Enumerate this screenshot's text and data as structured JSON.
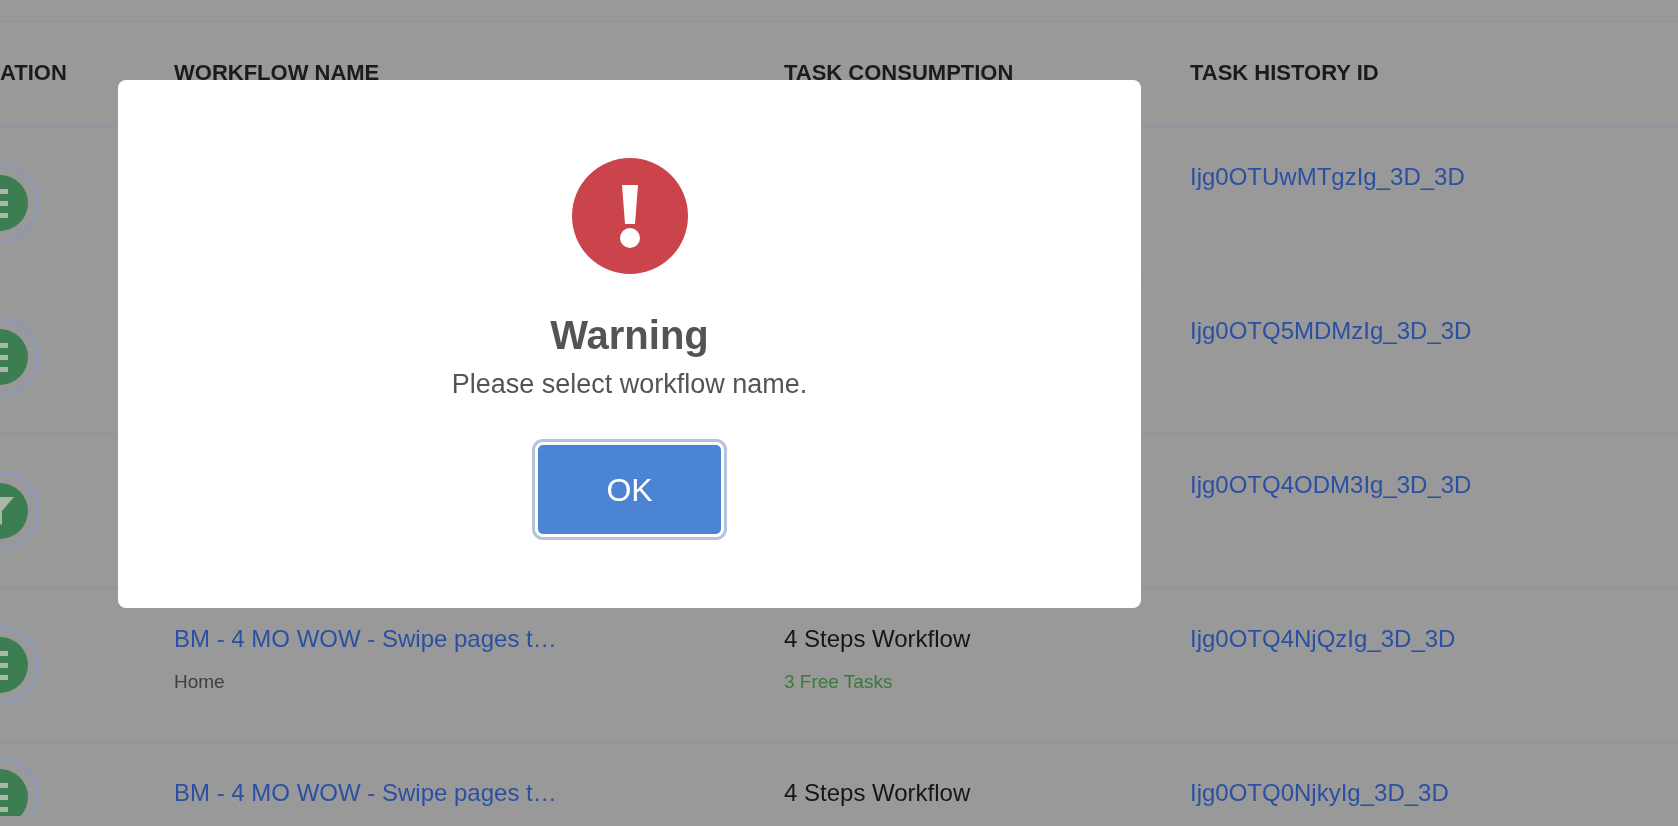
{
  "table": {
    "columns": [
      "ATION",
      "WORKFLOW NAME",
      "TASK CONSUMPTION",
      "TASK HISTORY ID"
    ],
    "rows": [
      {
        "kind": "list",
        "task_history_id": "Ijg0OTUwMTgzIg_3D_3D"
      },
      {
        "kind": "list",
        "task_history_id": "Ijg0OTQ5MDMzIg_3D_3D"
      },
      {
        "kind": "filter",
        "task_history_id": "Ijg0OTQ4ODM3Ig_3D_3D"
      },
      {
        "kind": "list",
        "workflow_name": "BM - 4 MO WOW - Swipe pages t…",
        "location": "Home",
        "consumption": "4 Steps Workflow",
        "free_tasks": "3 Free Tasks",
        "task_history_id": "Ijg0OTQ4NjQzIg_3D_3D"
      },
      {
        "kind": "list",
        "workflow_name": "BM - 4 MO WOW - Swipe pages t…",
        "consumption": "4 Steps Workflow",
        "task_history_id": "Ijg0OTQ0NjkyIg_3D_3D"
      }
    ]
  },
  "dialog": {
    "title": "Warning",
    "message": "Please select workflow name.",
    "buttons": [
      "OK"
    ]
  }
}
